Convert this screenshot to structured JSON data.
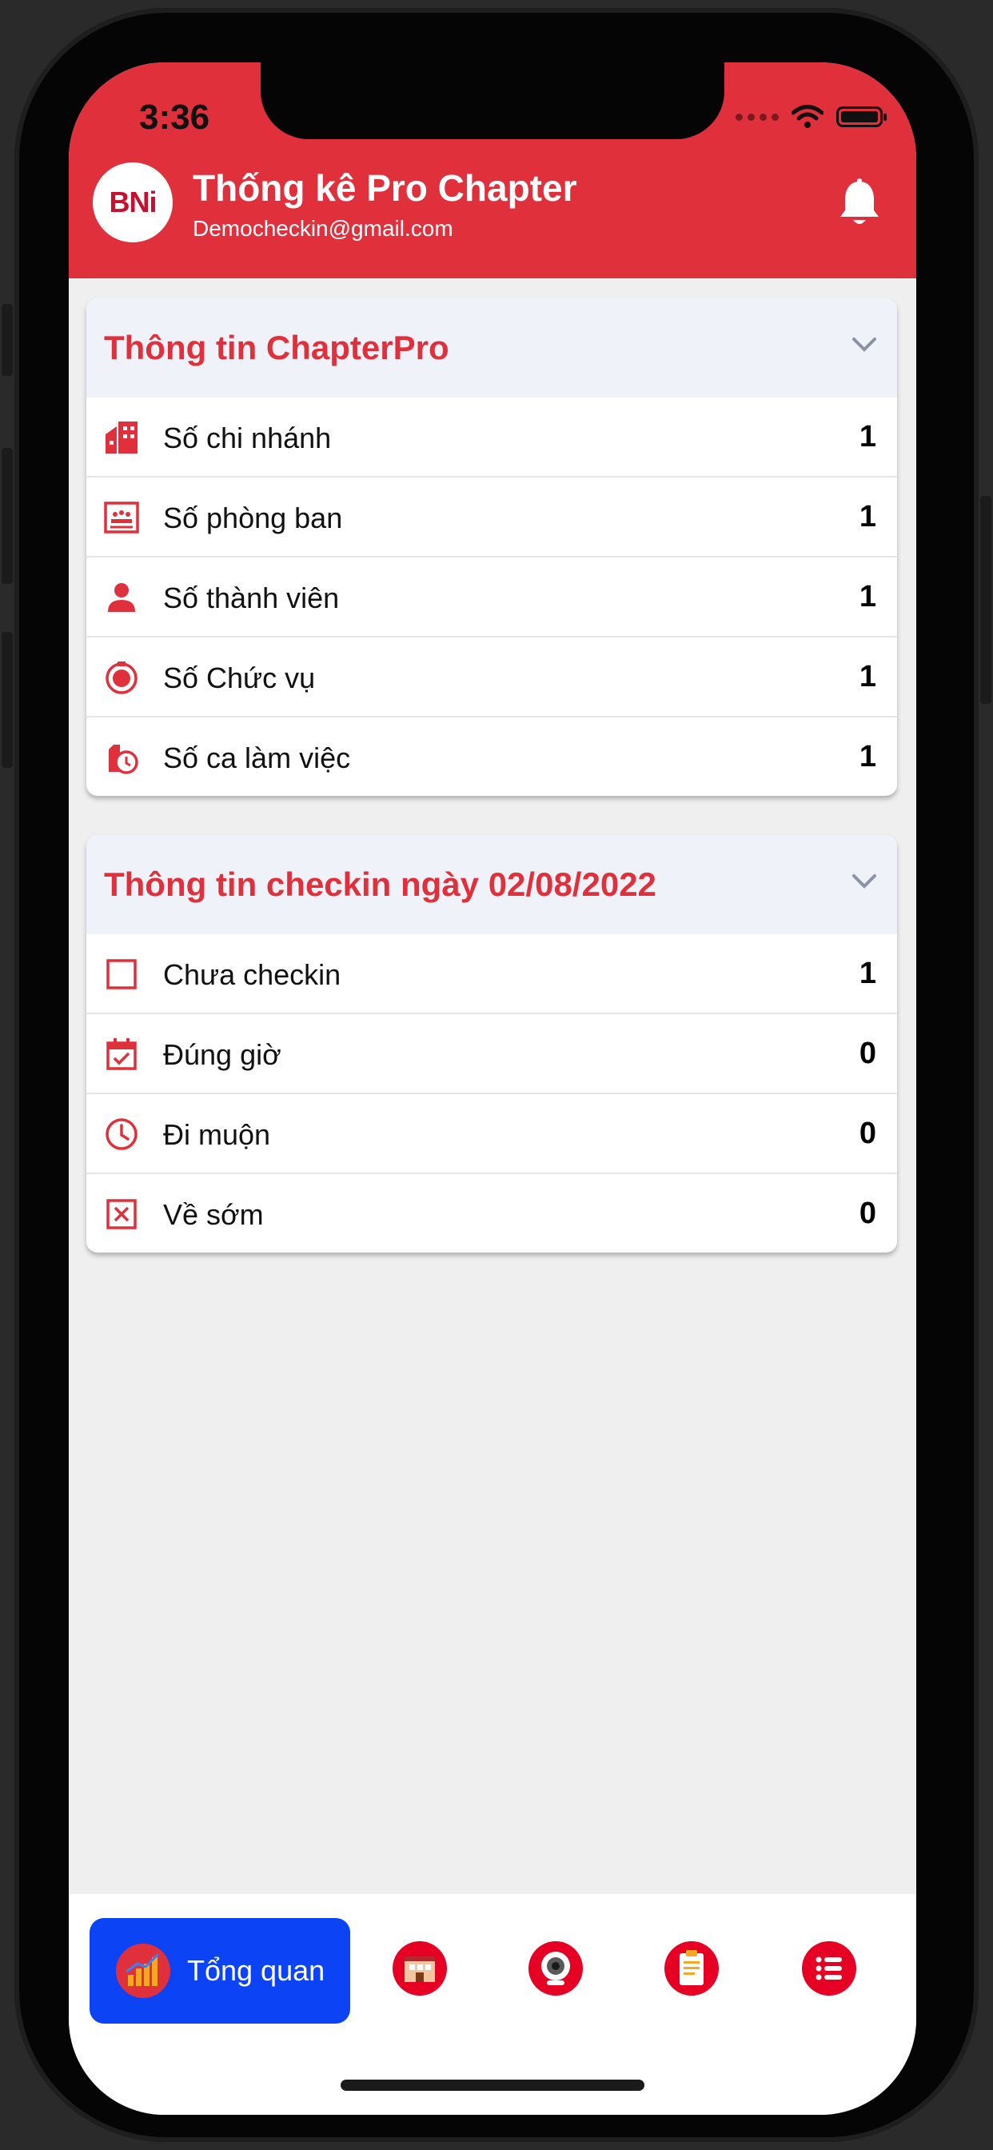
{
  "status_bar": {
    "time": "3:36"
  },
  "header": {
    "logo_text": "BNi",
    "title": "Thống kê Pro Chapter",
    "email": "Democheckin@gmail.com"
  },
  "chapter_card": {
    "title": "Thông tin ChapterPro",
    "rows": [
      {
        "label": "Số chi nhánh",
        "value": "1",
        "icon": "buildings-icon"
      },
      {
        "label": "Số phòng ban",
        "value": "1",
        "icon": "meeting-room-icon"
      },
      {
        "label": "Số thành viên",
        "value": "1",
        "icon": "person-icon"
      },
      {
        "label": "Số Chức vụ",
        "value": "1",
        "icon": "badge-icon"
      },
      {
        "label": "Số ca làm việc",
        "value": "1",
        "icon": "shift-clock-icon"
      }
    ]
  },
  "checkin_card": {
    "title": "Thông tin checkin ngày 02/08/2022",
    "rows": [
      {
        "label": "Chưa checkin",
        "value": "1",
        "icon": "empty-square-icon"
      },
      {
        "label": "Đúng giờ",
        "value": "0",
        "icon": "calendar-check-icon"
      },
      {
        "label": "Đi muộn",
        "value": "0",
        "icon": "clock-icon"
      },
      {
        "label": "Về sớm",
        "value": "0",
        "icon": "x-square-icon"
      }
    ]
  },
  "tabbar": {
    "active_label": "Tổng quan",
    "tabs": [
      "overview-chart-icon",
      "office-icon",
      "webcam-icon",
      "clipboard-icon",
      "list-icon"
    ]
  },
  "colors": {
    "brand_red": "#e0303c",
    "active_tab": "#0b43f5"
  }
}
